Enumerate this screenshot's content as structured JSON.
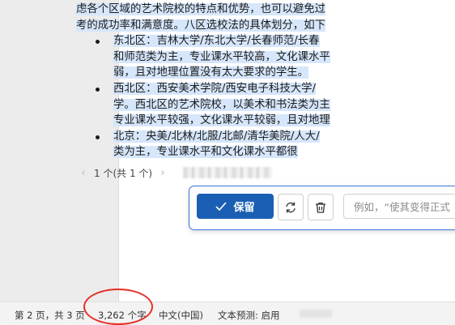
{
  "document": {
    "lines": [
      {
        "text": "虑各个区域的艺术院校的特点和优势，也可以避免过",
        "highlight": true
      },
      {
        "text": "考的成功率和满意度。八区选校法的具体划分，如下",
        "highlight": true
      }
    ],
    "bullets": [
      {
        "lines": [
          "东北区：吉林大学/东北大学/长春师范/长春",
          "和师范类为主，专业课水平较高，文化课水平",
          "弱，且对地理位置没有太大要求的学生。"
        ]
      },
      {
        "lines": [
          "西北区：西安美术学院/西安电子科技大学/",
          "学。西北区的艺术院校，以美术和书法类为主",
          "专业课水平较强，文化课水平较弱，且对地理"
        ]
      },
      {
        "lines": [
          "北京：央美/北林/北服/北邮/清华美院/人大/",
          "类为主，专业课水平和文化课水平都很"
        ]
      }
    ]
  },
  "pager": {
    "prev_icon": "chevron-left-icon",
    "count": "1 个(共 1 个)",
    "next_icon": "chevron-right-icon"
  },
  "actionbar": {
    "keep_label": "保留",
    "keep_icon": "checkmark-icon",
    "regen_icon": "regenerate-icon",
    "delete_icon": "trash-icon",
    "prompt_placeholder": "例如，“使其变得正式"
  },
  "statusbar": {
    "page": "第 2 页，共 3 页",
    "words": "3,262 个字",
    "language": "中文(中国)",
    "prediction": "文本预测: 启用"
  },
  "colors": {
    "accent": "#1a5fb4",
    "highlight": "#d6e6fb",
    "annotation": "#e53027"
  }
}
